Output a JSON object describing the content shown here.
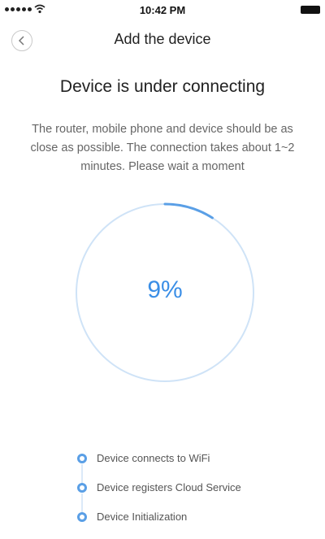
{
  "status_bar": {
    "time": "10:42 PM",
    "signal_icon": "signal-dots-icon",
    "wifi_icon": "wifi-icon",
    "battery_icon": "battery-icon"
  },
  "nav": {
    "back_icon": "chevron-left-icon",
    "title": "Add the device"
  },
  "headline": "Device is under connecting",
  "description": "The router, mobile phone and device should be as close as possible. The connection takes about 1~2 minutes. Please wait a moment",
  "progress": {
    "label": "9%",
    "value": 0.09,
    "ring_color": "#cfe3f7",
    "arc_color": "#5a9fe6",
    "text_color": "#3a8ee6"
  },
  "steps": [
    {
      "label": "Device connects to WiFi"
    },
    {
      "label": "Device registers Cloud Service"
    },
    {
      "label": "Device Initialization"
    }
  ]
}
